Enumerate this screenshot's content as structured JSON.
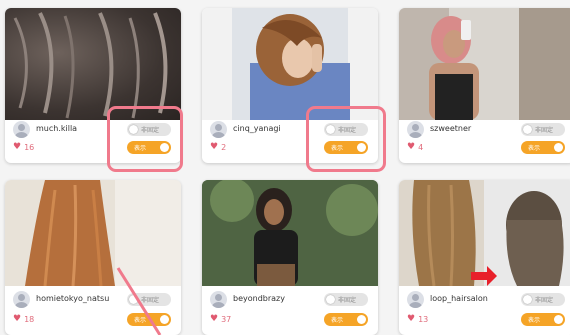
{
  "toggle_labels": {
    "pin": "非固定",
    "show": "表示"
  },
  "cards": [
    {
      "username": "much.killa",
      "likes": "16"
    },
    {
      "username": "cinq_yanagi",
      "likes": "2"
    },
    {
      "username": "szweetner",
      "likes": "4"
    },
    {
      "username": "homietokyo_natsu",
      "likes": "18"
    },
    {
      "username": "beyondbrazy",
      "likes": "37"
    },
    {
      "username": "loop_hairsalon",
      "likes": "13"
    }
  ],
  "colors": {
    "accent": "#f5a427",
    "highlight": "#f07a8c",
    "heart": "#e05a70"
  }
}
